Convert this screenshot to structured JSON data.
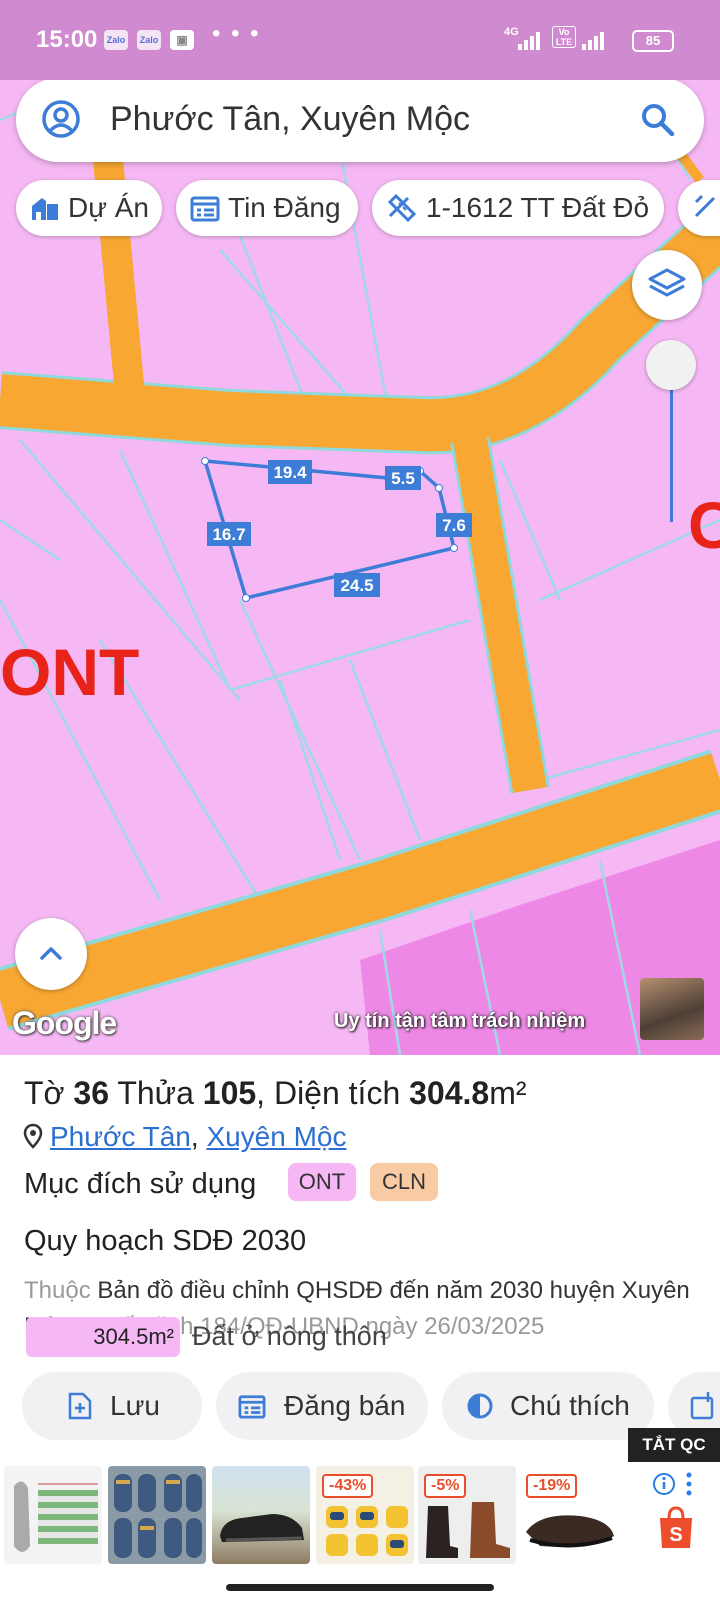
{
  "status_bar": {
    "time": "15:00",
    "apps": [
      "Zalo",
      "Zalo"
    ],
    "more": "• • •",
    "network_1": "4G",
    "network_2": "Vo LTE",
    "battery": "85"
  },
  "search": {
    "query": "Phước Tân, Xuyên Mộc",
    "icons": [
      "account-circle-icon",
      "search-icon"
    ]
  },
  "chips": [
    {
      "label": "Dự Án",
      "icon": "building-icon"
    },
    {
      "label": "Tin Đăng",
      "icon": "calendar-list-icon"
    },
    {
      "label": "1-1612 TT Đất Đỏ",
      "icon": "ruler-icon"
    }
  ],
  "map": {
    "zone_label": "ONT",
    "zone_label_partial": "C",
    "lot_edges": [
      "19.4",
      "5.5",
      "7.6",
      "24.5",
      "16.7"
    ],
    "google": "Google",
    "slogan": "Uy tín tận tâm trách nhiệm",
    "colors": {
      "residential": "#f6b8f4",
      "road": "#f7a732",
      "boundary": "#3d7dd8",
      "label": "#e8231a"
    }
  },
  "parcel": {
    "sheet_label": "Tờ",
    "sheet": "36",
    "plot_label": "Thửa",
    "plot": "105",
    "area_label": "Diện tích",
    "area": "304.8",
    "area_unit": "m²",
    "ward": "Phước Tân",
    "district": "Xuyên Mộc",
    "purpose_label": "Mục đích sử dụng",
    "purpose_tags": [
      {
        "label": "ONT",
        "color": "#f6b8f4"
      },
      {
        "label": "CLN",
        "color": "#f8cba4"
      }
    ],
    "plan_title": "Quy hoạch SDĐ 2030",
    "plan_prefix": "Thuộc",
    "plan_map": "Bản đồ điều chỉnh QHSDĐ đến năm 2030 huyện Xuyên Mộc",
    "plan_decision": ", quyết định 184/QĐ-UBND ngày 26/03/2025",
    "zone_area": "304.5m²",
    "zone_name": "Đất ở nông thôn"
  },
  "actions": [
    {
      "label": "Lưu",
      "icon": "add-file-icon"
    },
    {
      "label": "Đăng bán",
      "icon": "calendar-list-icon"
    },
    {
      "label": "Chú thích",
      "icon": "contrast-icon"
    }
  ],
  "ad": {
    "close_label": "TẮT QC",
    "discounts": [
      "-43%",
      "-5%",
      "-19%"
    ]
  }
}
